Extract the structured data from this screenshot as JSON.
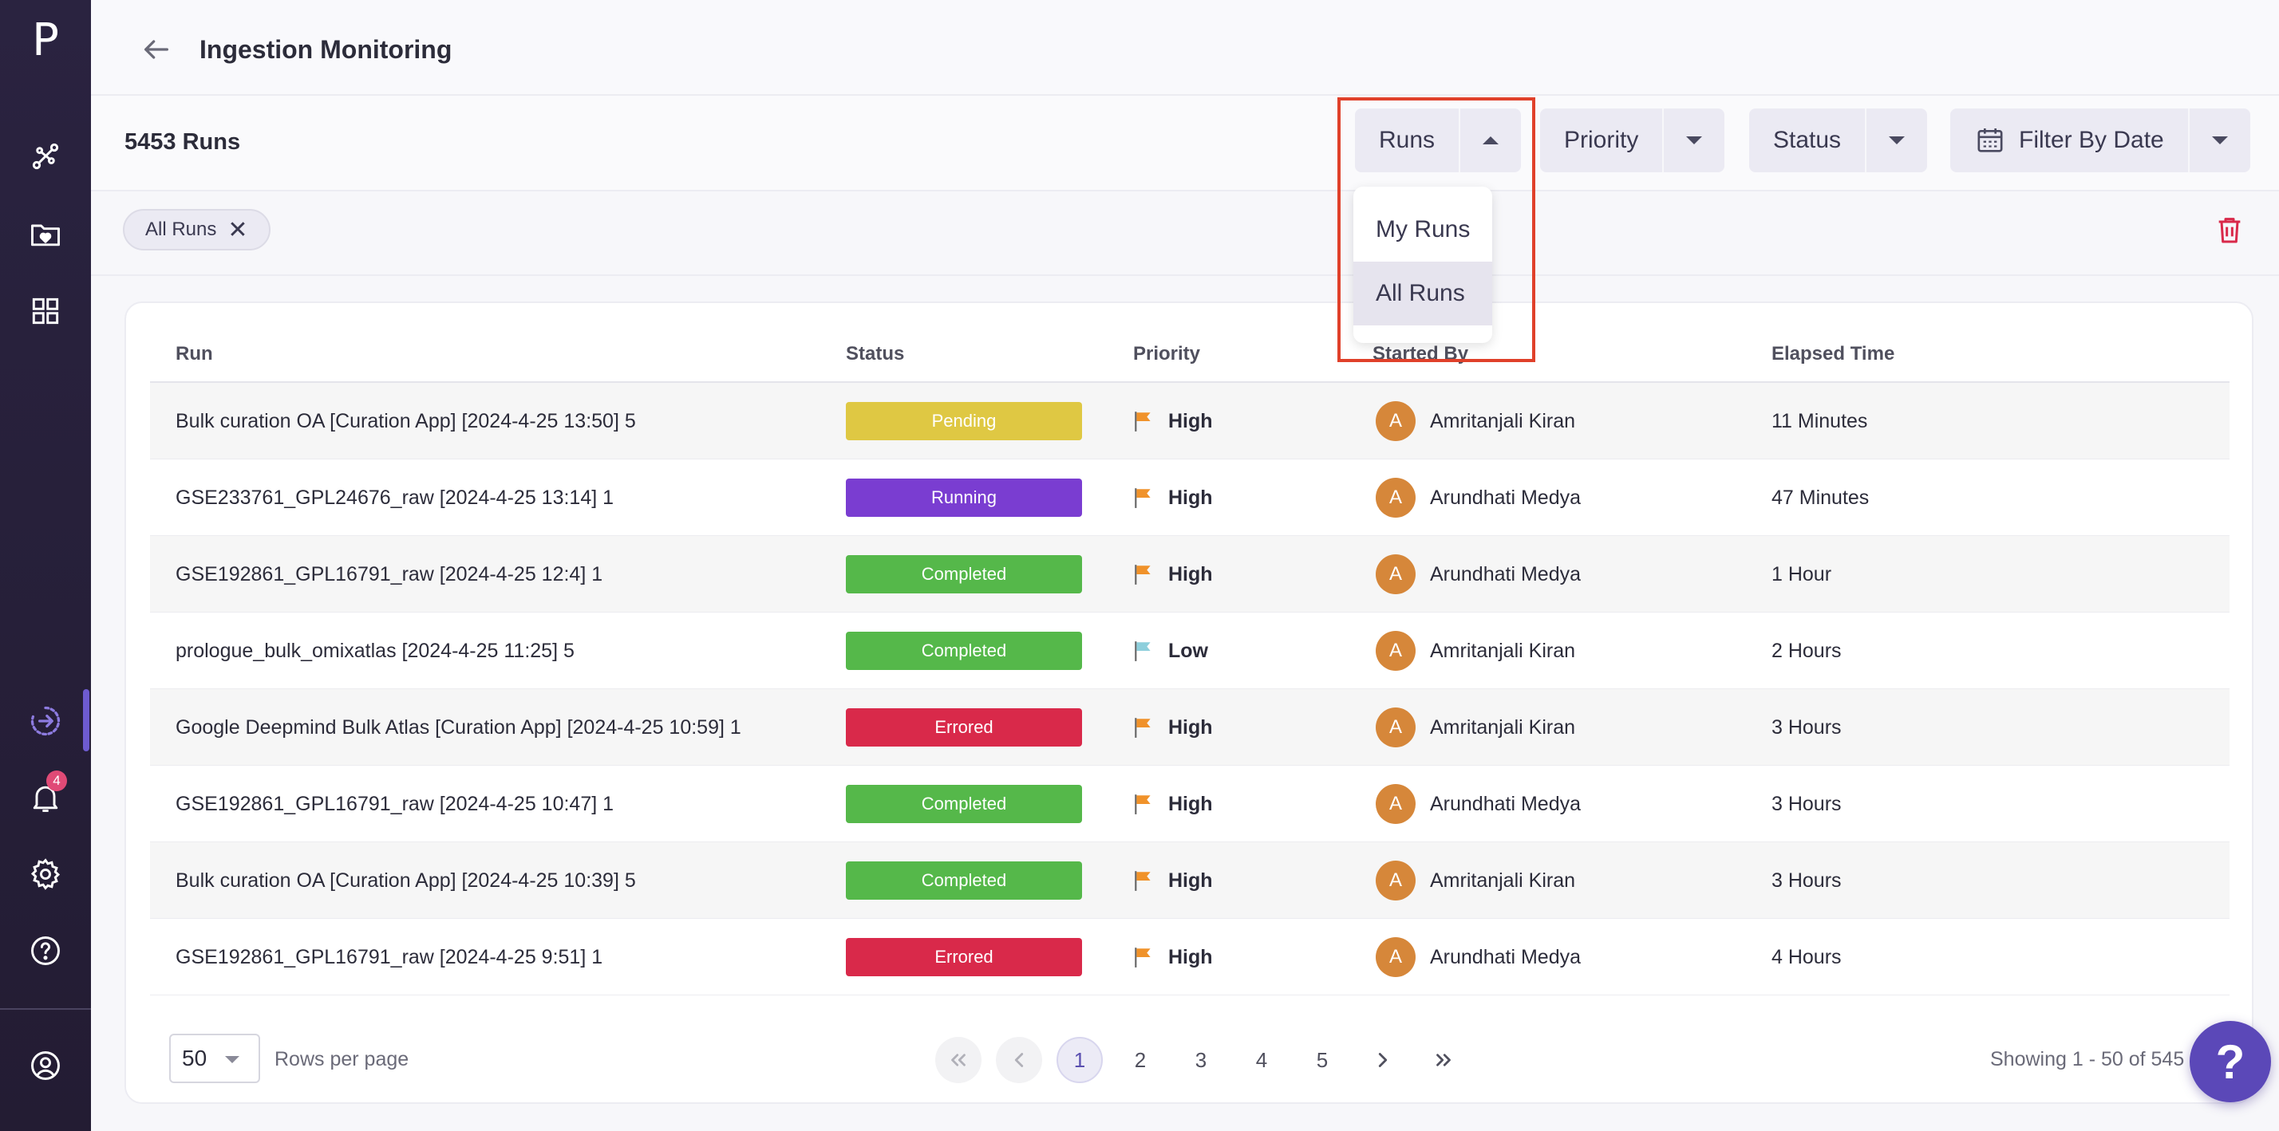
{
  "sidebar": {
    "logo": "P",
    "notification_count": "4",
    "items": [
      {
        "icon": "workflow-icon"
      },
      {
        "icon": "folder-heart-icon"
      },
      {
        "icon": "grid-icon"
      },
      {
        "icon": "ingestion-icon"
      },
      {
        "icon": "bell-icon"
      },
      {
        "icon": "gear-icon"
      },
      {
        "icon": "help-circle-icon"
      },
      {
        "icon": "user-circle-icon"
      }
    ]
  },
  "header": {
    "title": "Ingestion Monitoring"
  },
  "toolbar": {
    "runs_count": "5453 Runs",
    "filters": {
      "runs": "Runs",
      "priority": "Priority",
      "status": "Status",
      "date": "Filter By Date"
    }
  },
  "runs_dropdown": {
    "options": [
      "My Runs",
      "All Runs"
    ],
    "selected": "All Runs"
  },
  "chips": {
    "active": "All Runs"
  },
  "table": {
    "columns": [
      "Run",
      "Status",
      "Priority",
      "Started By",
      "Elapsed Time"
    ],
    "rows": [
      {
        "run": "Bulk curation OA [Curation App] [2024-4-25 13:50] 5",
        "status": "Pending",
        "status_color": "#dfc843",
        "priority": "High",
        "flag_color": "#f0922a",
        "initial": "A",
        "started_by": "Amritanjali Kiran",
        "elapsed": "11 Minutes"
      },
      {
        "run": "GSE233761_GPL24676_raw [2024-4-25 13:14] 1",
        "status": "Running",
        "status_color": "#7a3dd1",
        "priority": "High",
        "flag_color": "#f0922a",
        "initial": "A",
        "started_by": "Arundhati Medya",
        "elapsed": "47 Minutes"
      },
      {
        "run": "GSE192861_GPL16791_raw [2024-4-25 12:4] 1",
        "status": "Completed",
        "status_color": "#55b84a",
        "priority": "High",
        "flag_color": "#f0922a",
        "initial": "A",
        "started_by": "Arundhati Medya",
        "elapsed": "1 Hour"
      },
      {
        "run": "prologue_bulk_omixatlas [2024-4-25 11:25] 5",
        "status": "Completed",
        "status_color": "#55b84a",
        "priority": "Low",
        "flag_color": "#8ecfdc",
        "initial": "A",
        "started_by": "Amritanjali Kiran",
        "elapsed": "2 Hours"
      },
      {
        "run": "Google Deepmind Bulk Atlas [Curation App] [2024-4-25 10:59] 1",
        "status": "Errored",
        "status_color": "#d9294a",
        "priority": "High",
        "flag_color": "#f0922a",
        "initial": "A",
        "started_by": "Amritanjali Kiran",
        "elapsed": "3 Hours"
      },
      {
        "run": "GSE192861_GPL16791_raw [2024-4-25 10:47] 1",
        "status": "Completed",
        "status_color": "#55b84a",
        "priority": "High",
        "flag_color": "#f0922a",
        "initial": "A",
        "started_by": "Arundhati Medya",
        "elapsed": "3 Hours"
      },
      {
        "run": "Bulk curation OA [Curation App] [2024-4-25 10:39] 5",
        "status": "Completed",
        "status_color": "#55b84a",
        "priority": "High",
        "flag_color": "#f0922a",
        "initial": "A",
        "started_by": "Amritanjali Kiran",
        "elapsed": "3 Hours"
      },
      {
        "run": "GSE192861_GPL16791_raw [2024-4-25 9:51] 1",
        "status": "Errored",
        "status_color": "#d9294a",
        "priority": "High",
        "flag_color": "#f0922a",
        "initial": "A",
        "started_by": "Arundhati Medya",
        "elapsed": "4 Hours"
      }
    ]
  },
  "pagination": {
    "rows_per_page_value": "50",
    "rows_per_page_label": "Rows per page",
    "pages": [
      "1",
      "2",
      "3",
      "4",
      "5"
    ],
    "current_page": "1",
    "showing": "Showing 1 - 50 of 545"
  },
  "help_button": "?"
}
